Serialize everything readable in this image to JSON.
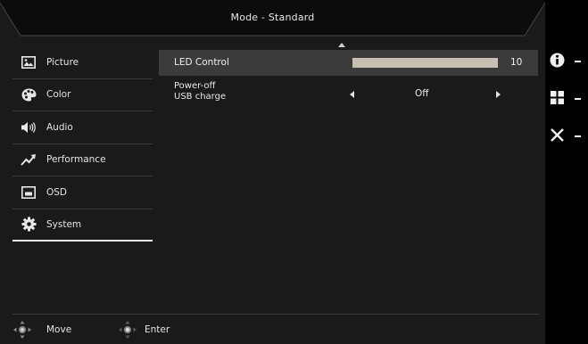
{
  "header": {
    "title": "Mode - Standard"
  },
  "sidebar": {
    "items": [
      {
        "label": "Picture",
        "icon": "picture-icon"
      },
      {
        "label": "Color",
        "icon": "palette-icon"
      },
      {
        "label": "Audio",
        "icon": "speaker-icon"
      },
      {
        "label": "Performance",
        "icon": "trend-arrow-icon"
      },
      {
        "label": "OSD",
        "icon": "osd-icon"
      },
      {
        "label": "System",
        "icon": "gear-icon",
        "active": true
      }
    ]
  },
  "content": {
    "led_control": {
      "label": "LED Control",
      "value": "10",
      "level": 1.0
    },
    "usb_charge": {
      "label_line1": "Power-off",
      "label_line2": "USB charge",
      "value": "Off"
    }
  },
  "footer": {
    "move_label": "Move",
    "enter_label": "Enter"
  },
  "hints": [
    "info-icon",
    "grid-icon",
    "close-icon"
  ],
  "colors": {
    "background": "#1a1a1a",
    "highlight_row": "#3b3b3b",
    "slider": "#c8bfb3"
  }
}
